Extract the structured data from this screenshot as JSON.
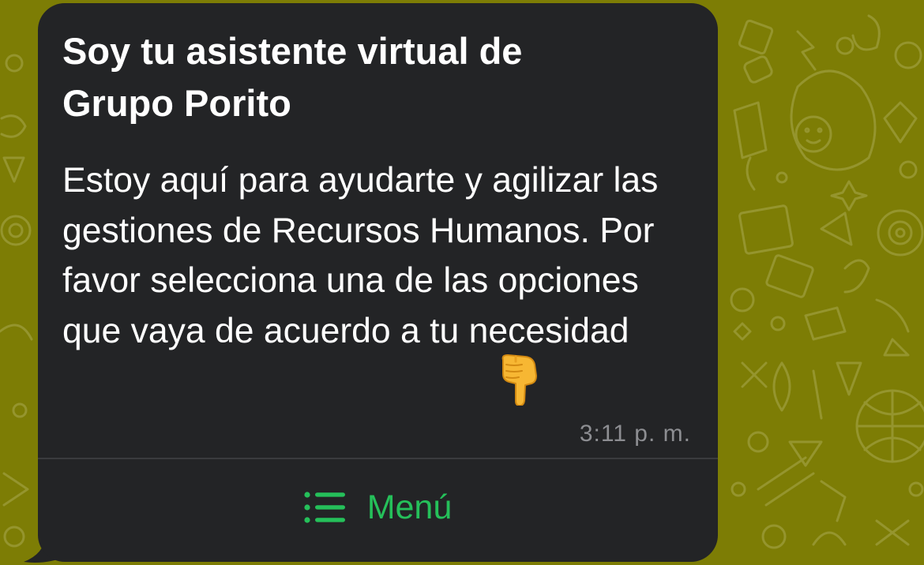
{
  "wallpaper": {
    "background_color": "#7d7d05",
    "doodle_color": "#9a9a37"
  },
  "message": {
    "title": "Soy tu asistente virtual de\nGrupo Porito",
    "body": "Estoy aquí para ayudarte y agilizar las gestiones de Recursos Humanos. Por favor selecciona una de las opciones que vaya de acuerdo a tu necesidad",
    "emoji": "backhand-index-pointing-down-icon",
    "timestamp": "3:11 p. m.",
    "bubble_color": "#232426"
  },
  "menu_button": {
    "label": "Menú",
    "icon": "list-icon",
    "color": "#25c05a"
  }
}
